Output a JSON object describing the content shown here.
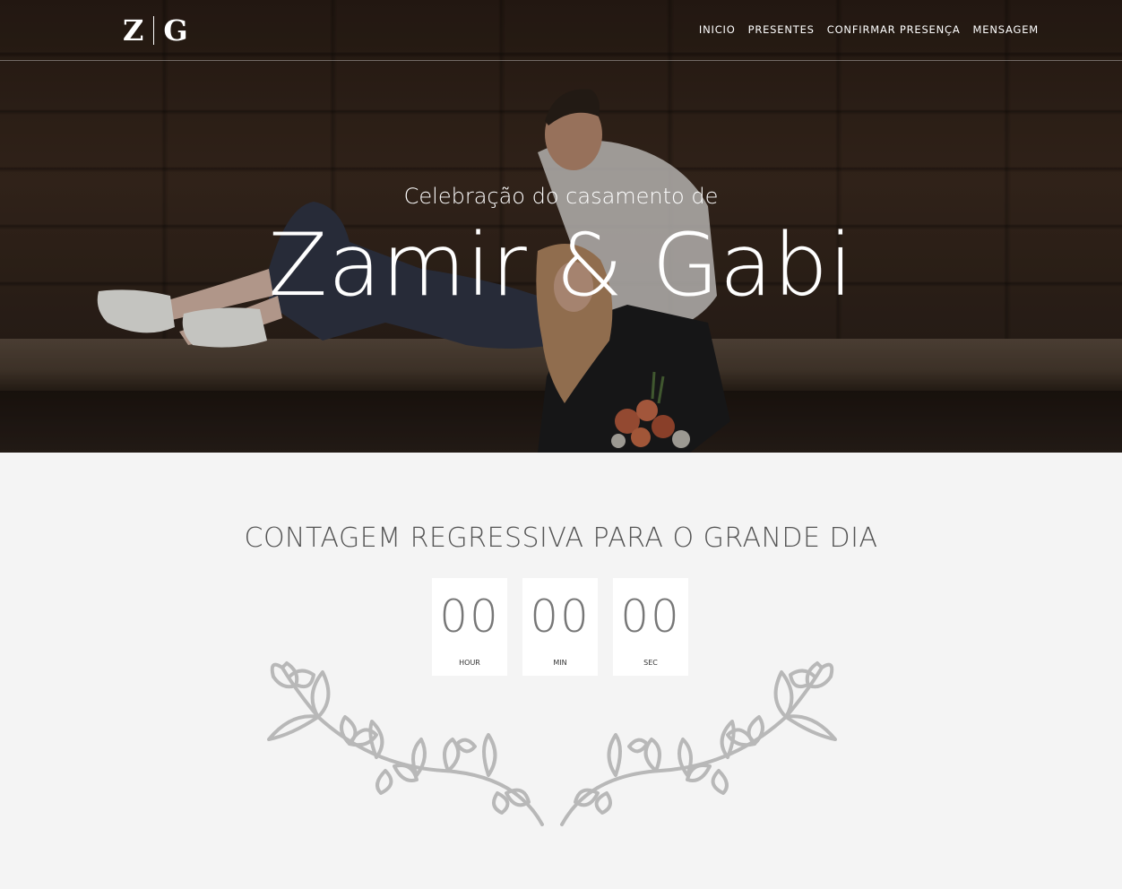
{
  "nav": {
    "logo_left": "Z",
    "logo_right": "G",
    "items": [
      "INICIO",
      "PRESENTES",
      "CONFIRMAR PRESENÇA",
      "MENSAGEM"
    ]
  },
  "hero": {
    "subtitle": "Celebração do casamento de",
    "title": "Zamir & Gabi"
  },
  "countdown": {
    "title": "CONTAGEM REGRESSIVA PARA O GRANDE DIA",
    "units": [
      {
        "value": "00",
        "label": "HOUR"
      },
      {
        "value": "00",
        "label": "MIN"
      },
      {
        "value": "00",
        "label": "SEC"
      }
    ]
  },
  "colors": {
    "page_background": "#f4f4f4",
    "hero_text": "#ffffff",
    "countdown_title": "#555555",
    "wreath": "#b8b8b8"
  }
}
